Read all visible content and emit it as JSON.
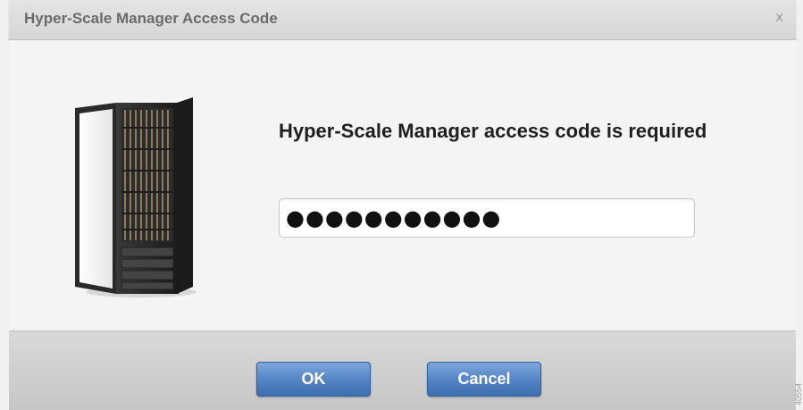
{
  "dialog": {
    "title": "Hyper-Scale Manager Access Code",
    "close_label": "x"
  },
  "content": {
    "icon": "server-rack-icon",
    "message": "Hyper-Scale Manager access code is required",
    "access_code_masked": "●●●●●●●●●●●"
  },
  "footer": {
    "ok_label": "OK",
    "cancel_label": "Cancel"
  },
  "watermark": "40554",
  "colors": {
    "button_blue": "#5a88c9",
    "title_text": "#6b6b6b",
    "message_text": "#1f1f1f"
  }
}
